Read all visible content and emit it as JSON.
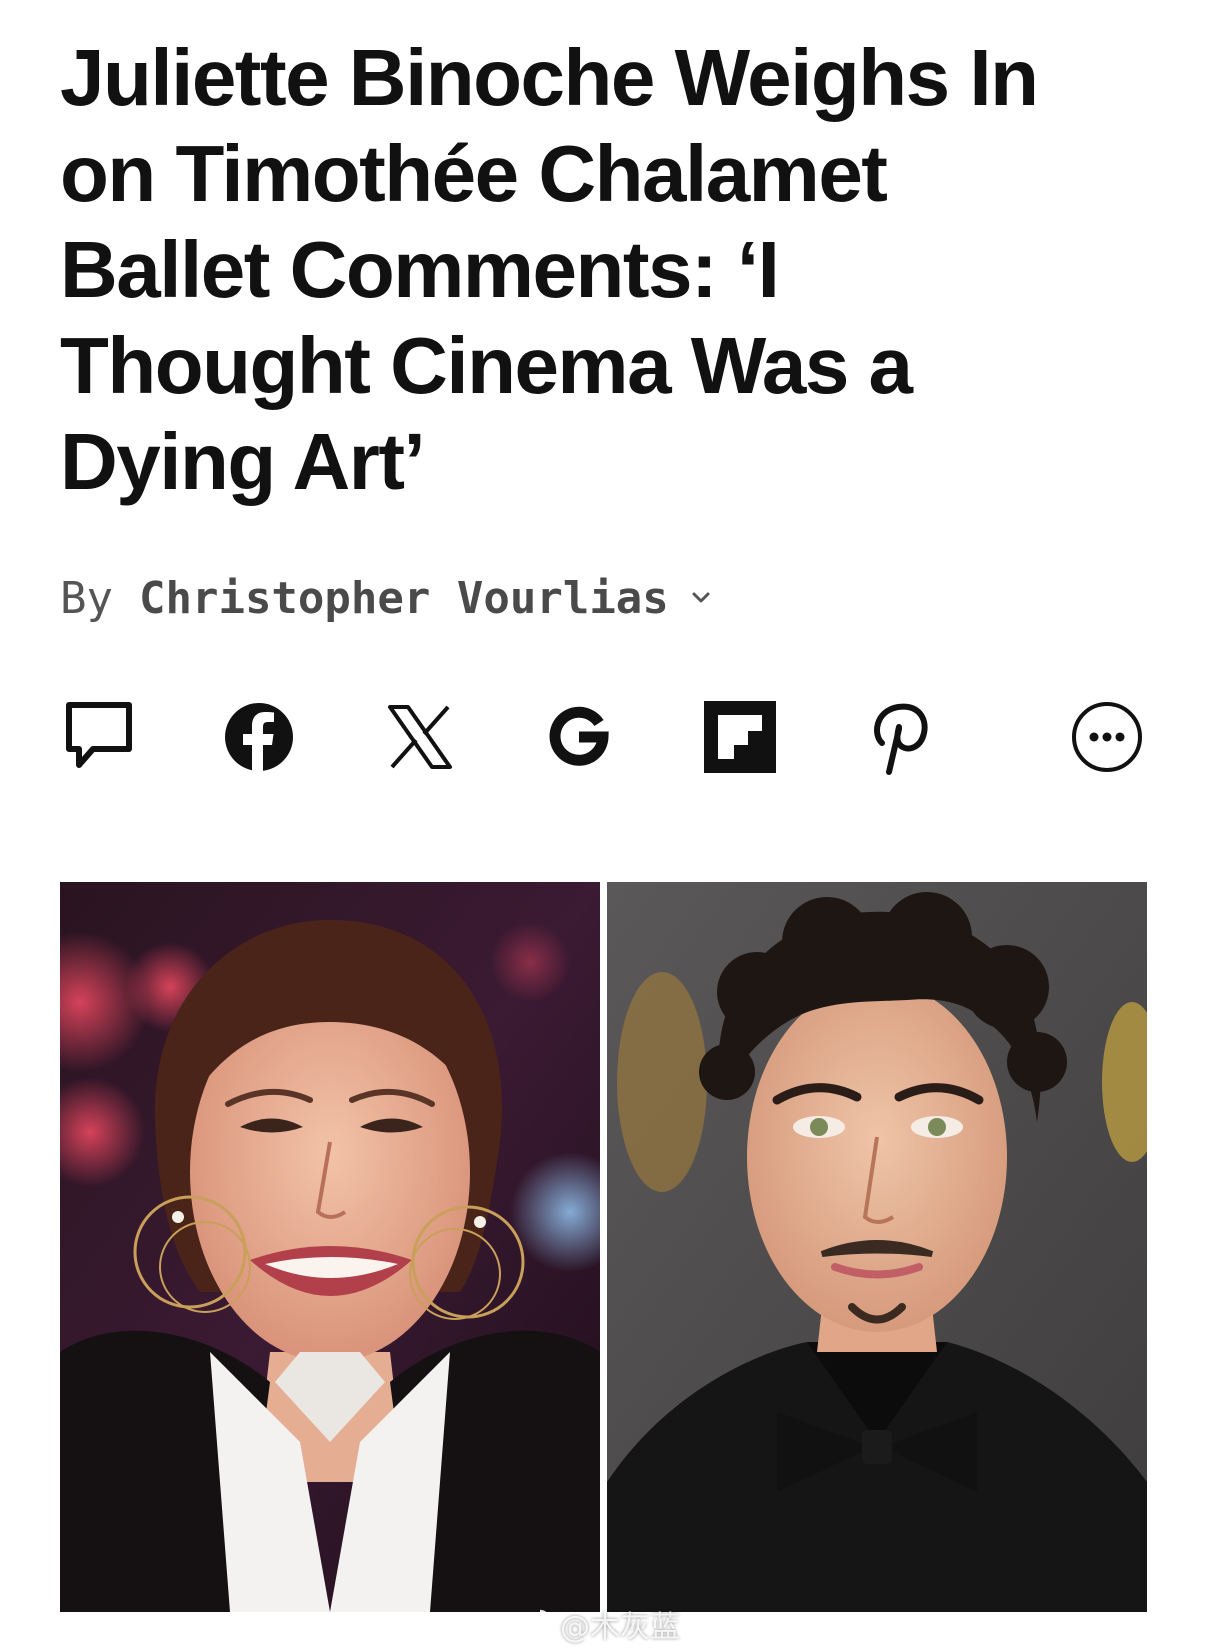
{
  "article": {
    "headline_lines": [
      "Juliette Binoche Weighs In",
      "on Timothée Chalamet",
      "Ballet Comments: ‘I",
      "Thought Cinema Was a",
      "Dying Art’"
    ],
    "byline": {
      "prefix": "By",
      "author": "Christopher Vourlias"
    }
  },
  "share_icons": [
    "comment-icon",
    "facebook-icon",
    "x-icon",
    "google-icon",
    "flipboard-icon",
    "pinterest-icon",
    "more-icon"
  ],
  "images": [
    "Juliette Binoche portrait",
    "Timothée Chalamet portrait"
  ],
  "watermark": {
    "text": "@木灰蓝"
  },
  "colors": {
    "text": "#111111",
    "byline": "#555555",
    "icon": "#111111"
  }
}
